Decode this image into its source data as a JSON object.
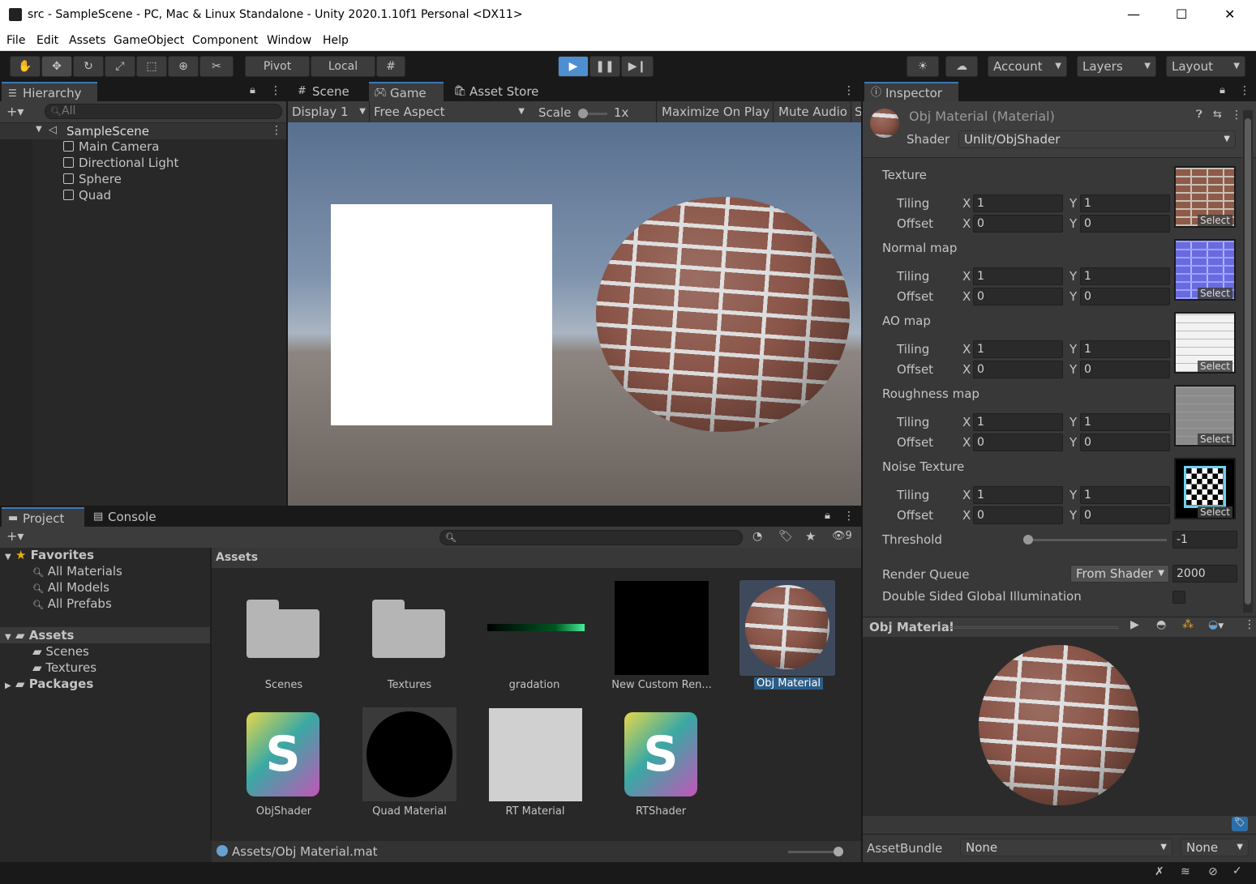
{
  "window": {
    "title": "src - SampleScene - PC, Mac & Linux Standalone - Unity 2020.1.10f1 Personal <DX11>",
    "controls": [
      "—",
      "☐",
      "✕"
    ]
  },
  "menu": [
    "File",
    "Edit",
    "Assets",
    "GameObject",
    "Component",
    "Window",
    "Help"
  ],
  "toolbar": {
    "pivot": "Pivot",
    "local": "Local",
    "account": "Account",
    "layers": "Layers",
    "layout": "Layout"
  },
  "hierarchy": {
    "tab": "Hierarchy",
    "search_placeholder": "All",
    "scene": "SampleScene",
    "items": [
      "Main Camera",
      "Directional Light",
      "Sphere",
      "Quad"
    ]
  },
  "game_view": {
    "tabs": [
      "Scene",
      "Game",
      "Asset Store"
    ],
    "display": "Display 1",
    "aspect": "Free Aspect",
    "scale_label": "Scale",
    "scale_value": "1x",
    "maximize": "Maximize On Play",
    "mute": "Mute Audio",
    "stats_cut": "S"
  },
  "project": {
    "tabs": [
      "Project",
      "Console"
    ],
    "favorites_label": "Favorites",
    "favorites": [
      "All Materials",
      "All Models",
      "All Prefabs"
    ],
    "assets_label": "Assets",
    "asset_folders": [
      "Scenes",
      "Textures"
    ],
    "packages_label": "Packages",
    "breadcrumb": "Assets",
    "hidden_count": "9",
    "assets": [
      {
        "name": "Scenes",
        "kind": "folder"
      },
      {
        "name": "Textures",
        "kind": "folder"
      },
      {
        "name": "gradation",
        "kind": "gradient"
      },
      {
        "name": "New Custom Ren...",
        "kind": "black"
      },
      {
        "name": "Obj Material",
        "kind": "sphere"
      },
      {
        "name": "ObjShader",
        "kind": "shader"
      },
      {
        "name": "Quad Material",
        "kind": "circle"
      },
      {
        "name": "RT  Material",
        "kind": "gray"
      },
      {
        "name": "RTShader",
        "kind": "shader"
      }
    ],
    "status_path": "Assets/Obj Material.mat"
  },
  "inspector": {
    "tab": "Inspector",
    "object_name": "Obj Material (Material)",
    "shader_label": "Shader",
    "shader_value": "Unlit/ObjShader",
    "tiling_label": "Tiling",
    "offset_label": "Offset",
    "x_label": "X",
    "y_label": "Y",
    "select_label": "Select",
    "textures": [
      {
        "label": "Texture",
        "tiling_x": "1",
        "tiling_y": "1",
        "offset_x": "0",
        "offset_y": "0",
        "thumb": "brick"
      },
      {
        "label": "Normal map",
        "tiling_x": "1",
        "tiling_y": "1",
        "offset_x": "0",
        "offset_y": "0",
        "thumb": "normal"
      },
      {
        "label": "AO map",
        "tiling_x": "1",
        "tiling_y": "1",
        "offset_x": "0",
        "offset_y": "0",
        "thumb": "ao"
      },
      {
        "label": "Roughness map",
        "tiling_x": "1",
        "tiling_y": "1",
        "offset_x": "0",
        "offset_y": "0",
        "thumb": "rough"
      },
      {
        "label": "Noise Texture",
        "tiling_x": "1",
        "tiling_y": "1",
        "offset_x": "0",
        "offset_y": "0",
        "thumb": "noise"
      }
    ],
    "threshold_label": "Threshold",
    "threshold_value": "-1",
    "threshold_fraction": 0.0,
    "render_queue_label": "Render Queue",
    "render_queue_mode": "From Shader",
    "render_queue_value": "2000",
    "double_sided_label": "Double Sided Global Illumination",
    "preview_title": "Obj Material",
    "assetbundle_label": "AssetBundle",
    "assetbundle_value": "None",
    "assetbundle_variant": "None"
  },
  "colors": {
    "accent": "#3a79bb",
    "play_active": "#4d8fd1",
    "panel": "#282828",
    "dark": "#191919"
  }
}
